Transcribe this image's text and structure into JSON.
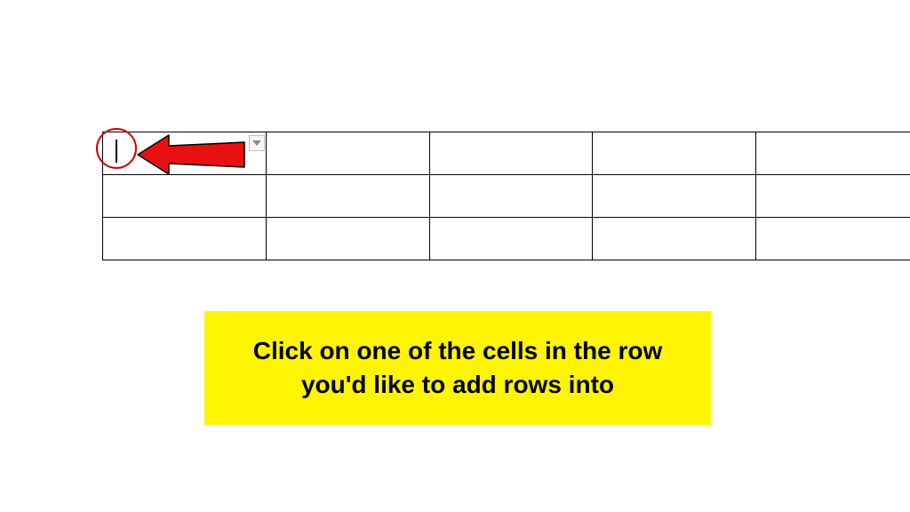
{
  "table": {
    "rows": 3,
    "cols": 5
  },
  "annotation": {
    "instruction": "Click on one of the cells in the row you'd like to add rows into"
  },
  "icons": {
    "dropdown": "chevron-down"
  }
}
